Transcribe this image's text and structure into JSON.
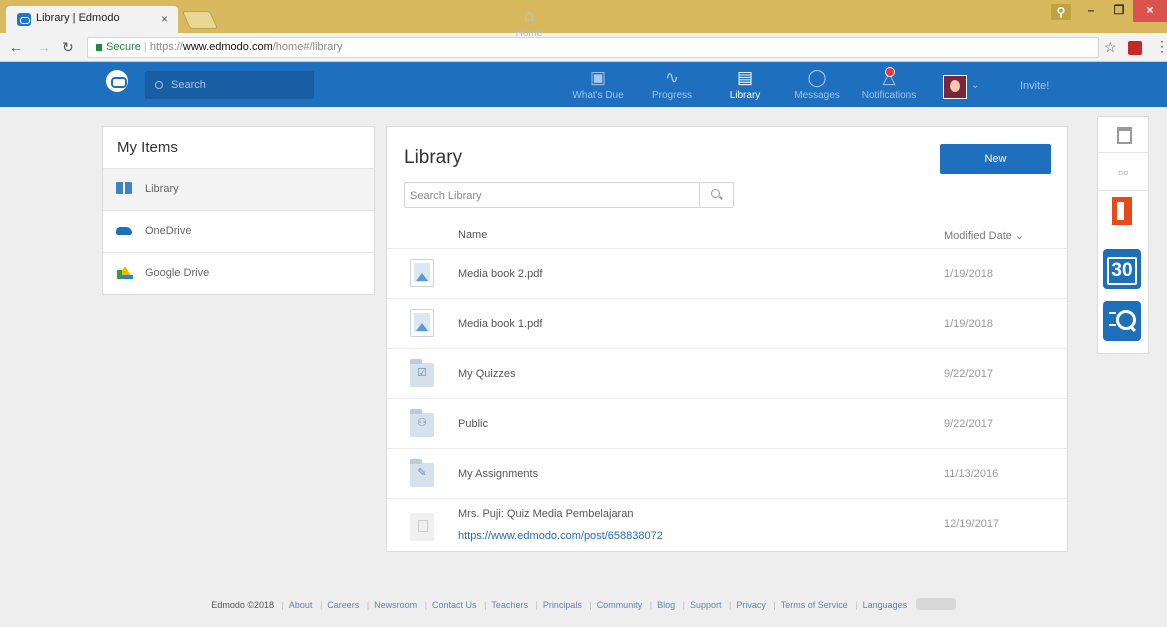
{
  "browser": {
    "tab_title": "Library | Edmodo",
    "tab_close": "×",
    "secure_label": "Secure",
    "url_scheme": "https://",
    "url_host": "www.edmodo.com",
    "url_path": "/home#/library",
    "window_buttons": {
      "minimize": "–",
      "maximize": "❐",
      "close": "×"
    }
  },
  "header": {
    "search_placeholder": "Search",
    "nav": [
      {
        "label": "Home",
        "icon": "house-icon",
        "glyph": "⌂"
      },
      {
        "label": "What's Due",
        "icon": "calendar-icon",
        "glyph": "▣"
      },
      {
        "label": "Progress",
        "icon": "pulse-icon",
        "glyph": "∿"
      },
      {
        "label": "Library",
        "icon": "library-icon",
        "glyph": "▤"
      },
      {
        "label": "Messages",
        "icon": "chat-bubble-icon",
        "glyph": "◯"
      },
      {
        "label": "Notifications",
        "icon": "bell-icon",
        "glyph": "△"
      }
    ],
    "invite_label": "Invite!"
  },
  "left_panel": {
    "title": "My Items",
    "items": [
      {
        "label": "Library",
        "icon": "library-book-icon"
      },
      {
        "label": "OneDrive",
        "icon": "onedrive-icon"
      },
      {
        "label": "Google Drive",
        "icon": "google-drive-icon"
      }
    ]
  },
  "library": {
    "title": "Library",
    "new_button": "New",
    "search_placeholder": "Search Library",
    "col_name": "Name",
    "col_date": "Modified Date ⌄",
    "rows": [
      {
        "name": "Media book 2.pdf",
        "date": "1/19/2018",
        "icon": "image-file-icon"
      },
      {
        "name": "Media book 1.pdf",
        "date": "1/19/2018",
        "icon": "image-file-icon"
      },
      {
        "name": "My Quizzes",
        "date": "9/22/2017",
        "icon": "quiz-folder-icon",
        "glyph": "☑"
      },
      {
        "name": "Public",
        "date": "9/22/2017",
        "icon": "public-folder-icon",
        "glyph": "⚇"
      },
      {
        "name": "My Assignments",
        "date": "11/13/2016",
        "icon": "assignment-folder-icon",
        "glyph": "✎"
      },
      {
        "name": "Mrs. Puji: Quiz Media Pembelajaran",
        "link": "https://www.edmodo.com/post/658838072",
        "date": "12/19/2017",
        "icon": "post-icon"
      }
    ]
  },
  "rail": {
    "grid_glyph": "▫▫",
    "calendar_label": "30"
  },
  "footer": {
    "copyright": "Edmodo ©2018",
    "links": [
      "About",
      "Careers",
      "Newsroom",
      "Contact Us",
      "Teachers",
      "Principals",
      "Community",
      "Blog",
      "Support",
      "Privacy",
      "Terms of Service",
      "Languages"
    ]
  },
  "colors": {
    "brand_blue": "#1f6fbf",
    "tab_bar": "#d8b95e",
    "new_button": "#1f6fbf",
    "office_red": "#e64a19"
  }
}
